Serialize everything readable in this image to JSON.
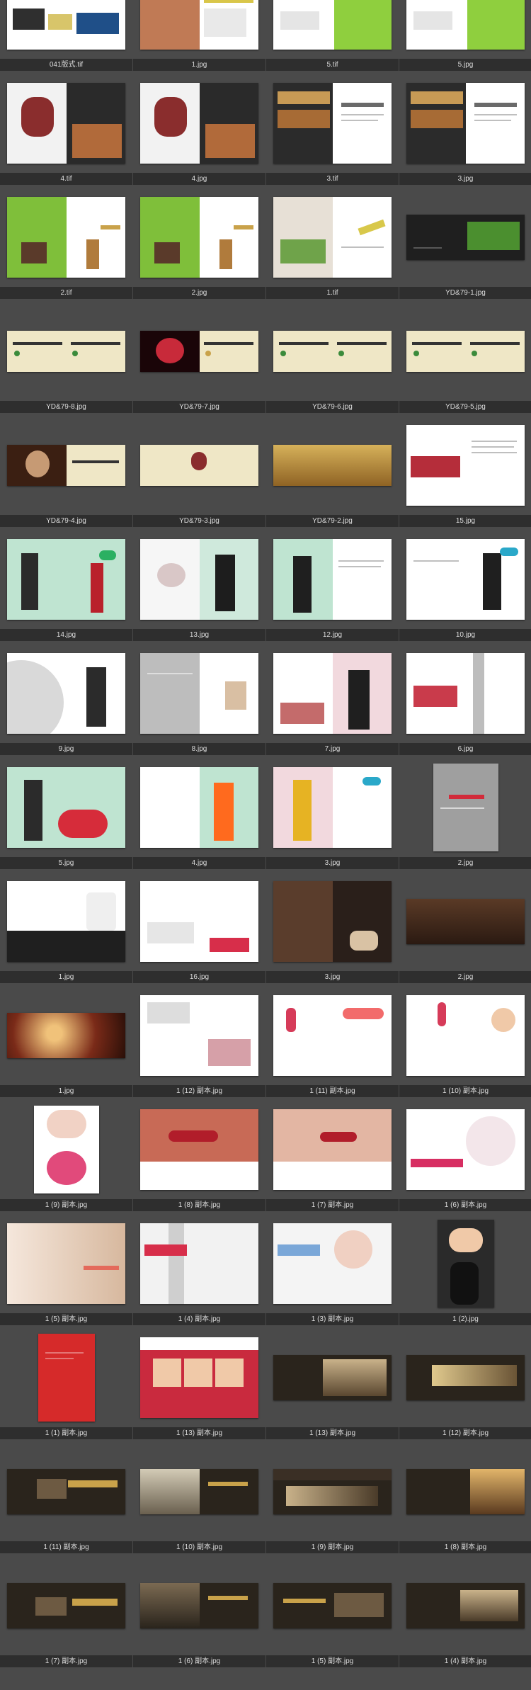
{
  "file_browser": {
    "items": [
      {
        "name": "041版式.tif"
      },
      {
        "name": "1.jpg"
      },
      {
        "name": "5.tif"
      },
      {
        "name": "5.jpg"
      },
      {
        "name": "4.tif"
      },
      {
        "name": "4.jpg"
      },
      {
        "name": "3.tif"
      },
      {
        "name": "3.jpg"
      },
      {
        "name": "2.tif"
      },
      {
        "name": "2.jpg"
      },
      {
        "name": "1.tif"
      },
      {
        "name": "YD&79-1.jpg"
      },
      {
        "name": "YD&79-8.jpg"
      },
      {
        "name": "YD&79-7.jpg"
      },
      {
        "name": "YD&79-6.jpg"
      },
      {
        "name": "YD&79-5.jpg"
      },
      {
        "name": "YD&79-4.jpg"
      },
      {
        "name": "YD&79-3.jpg"
      },
      {
        "name": "YD&79-2.jpg"
      },
      {
        "name": "15.jpg"
      },
      {
        "name": "14.jpg"
      },
      {
        "name": "13.jpg"
      },
      {
        "name": "12.jpg"
      },
      {
        "name": "10.jpg"
      },
      {
        "name": "9.jpg"
      },
      {
        "name": "8.jpg"
      },
      {
        "name": "7.jpg"
      },
      {
        "name": "6.jpg"
      },
      {
        "name": "5.jpg"
      },
      {
        "name": "4.jpg"
      },
      {
        "name": "3.jpg"
      },
      {
        "name": "2.jpg"
      },
      {
        "name": "1.jpg"
      },
      {
        "name": "16.jpg"
      },
      {
        "name": "3.jpg"
      },
      {
        "name": "2.jpg"
      },
      {
        "name": "1.jpg"
      },
      {
        "name": "1 (12) 副本.jpg"
      },
      {
        "name": "1 (11) 副本.jpg"
      },
      {
        "name": "1 (10) 副本.jpg"
      },
      {
        "name": "1 (9) 副本.jpg"
      },
      {
        "name": "1 (8) 副本.jpg"
      },
      {
        "name": "1 (7) 副本.jpg"
      },
      {
        "name": "1 (6) 副本.jpg"
      },
      {
        "name": "1 (5) 副本.jpg"
      },
      {
        "name": "1 (4) 副本.jpg"
      },
      {
        "name": "1 (3) 副本.jpg"
      },
      {
        "name": "1 (2).jpg"
      },
      {
        "name": "1 (1) 副本.jpg"
      },
      {
        "name": "1 (13) 副本.jpg"
      },
      {
        "name": "1 (13) 副本.jpg"
      },
      {
        "name": "1 (12) 副本.jpg"
      },
      {
        "name": "1 (11) 副本.jpg"
      },
      {
        "name": "1 (10) 副本.jpg"
      },
      {
        "name": "1 (9) 副本.jpg"
      },
      {
        "name": "1 (8) 副本.jpg"
      },
      {
        "name": "1 (7) 副本.jpg"
      },
      {
        "name": "1 (6) 副本.jpg"
      },
      {
        "name": "1 (5) 副本.jpg"
      },
      {
        "name": "1 (4) 副本.jpg"
      }
    ]
  }
}
